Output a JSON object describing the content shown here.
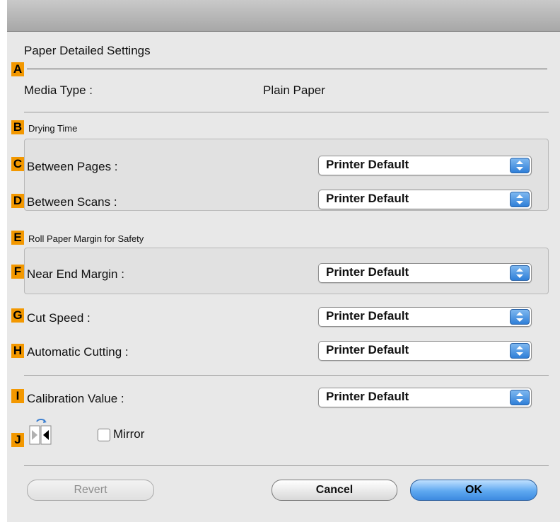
{
  "dialog": {
    "title": "Paper Detailed Settings"
  },
  "badges": [
    "A",
    "B",
    "C",
    "D",
    "E",
    "F",
    "G",
    "H",
    "I",
    "J"
  ],
  "media_type": {
    "label": "Media Type :",
    "value": "Plain Paper"
  },
  "drying_time": {
    "group_label": "Drying Time",
    "between_pages": {
      "label": "Between Pages :",
      "value": "Printer Default"
    },
    "between_scans": {
      "label": "Between Scans :",
      "value": "Printer Default"
    }
  },
  "roll_margin": {
    "group_label": "Roll Paper Margin for Safety",
    "near_end": {
      "label": "Near End Margin :",
      "value": "Printer Default"
    }
  },
  "cut_speed": {
    "label": "Cut Speed :",
    "value": "Printer Default"
  },
  "automatic_cutting": {
    "label": "Automatic Cutting :",
    "value": "Printer Default"
  },
  "calibration": {
    "label": "Calibration Value :",
    "value": "Printer Default"
  },
  "mirror": {
    "label": "Mirror",
    "checked": false,
    "icon": "mirror-icon"
  },
  "buttons": {
    "revert": "Revert",
    "cancel": "Cancel",
    "ok": "OK"
  },
  "colors": {
    "badge": "#f39800",
    "accent": "#3c8ae0"
  }
}
